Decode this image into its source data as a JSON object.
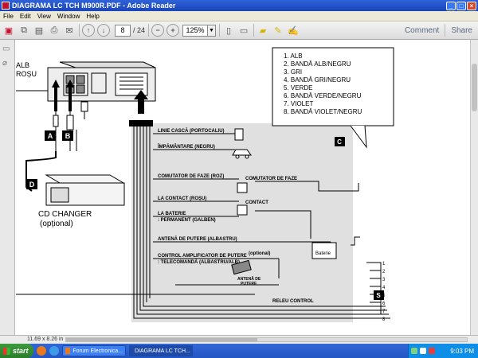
{
  "window": {
    "title": "DIAGRAMA LC TCH M900R.PDF - Adobe Reader"
  },
  "menu": [
    "File",
    "Edit",
    "View",
    "Window",
    "Help"
  ],
  "toolbar": {
    "page_current": "8",
    "page_total": "/ 24",
    "zoom": "125%",
    "comment": "Comment",
    "share": "Share"
  },
  "diagram": {
    "top_left_labels": [
      "ALB",
      "ROȘU"
    ],
    "connector_labels": [
      "A",
      "B",
      "D",
      "C",
      "S"
    ],
    "cd_changer": "CD CHANGER",
    "cd_optional": "(opțional)",
    "legend": [
      "1. ALB",
      "2. BANDĂ ALB/NEGRU",
      "3. GRI",
      "4. BANDĂ GRI/NEGRU",
      "5. VERDE",
      "6. BANDĂ VERDE/NEGRU",
      "7. VIOLET",
      "8. BANDĂ VIOLET/NEGRU"
    ],
    "wire_labels": {
      "headphone": "LINIE CASCĂ (PORTOCALIU)",
      "ground": "ÎMPĂMÂNTARE (NEGRU)",
      "phase_switch": "COMUTATOR DE FAZE (ROZ)",
      "phase_switch_box": "COMUTATOR DE FAZE",
      "contact": "LA CONTACT (ROȘU)",
      "contact_box": "CONTACT",
      "battery_line1": "LA BATERIE",
      "battery_line2": ": PERMANENT (GALBEN)",
      "battery_box": "Baterie",
      "power_antenna": "ANTENĂ DE PUTERE  (ALBASTRU)",
      "amp_control_1": "CONTROL AMPLIFICATOR DE PUTERE",
      "amp_control_2": ": TELECOMANDĂ (ALBASTRU/ALB)",
      "optional": "(optional)",
      "antenna_1": "ANTENĂ DE",
      "antenna_2": "PUTERE",
      "relay": "RELEU CONTROL"
    },
    "speaker_numbers": [
      "1",
      "2",
      "3",
      "4",
      "5",
      "6",
      "7",
      "8"
    ]
  },
  "status": {
    "page_size": "11.69 x 8.26 in"
  },
  "taskbar": {
    "start": "start",
    "items": [
      "Forum Electronica...",
      "DIAGRAMA LC TCH..."
    ],
    "clock": "9:03 PM"
  },
  "colors": {
    "titlebar": "#1a45b8",
    "shaded_panel": "#e0e0e0",
    "wire": "#000000"
  }
}
